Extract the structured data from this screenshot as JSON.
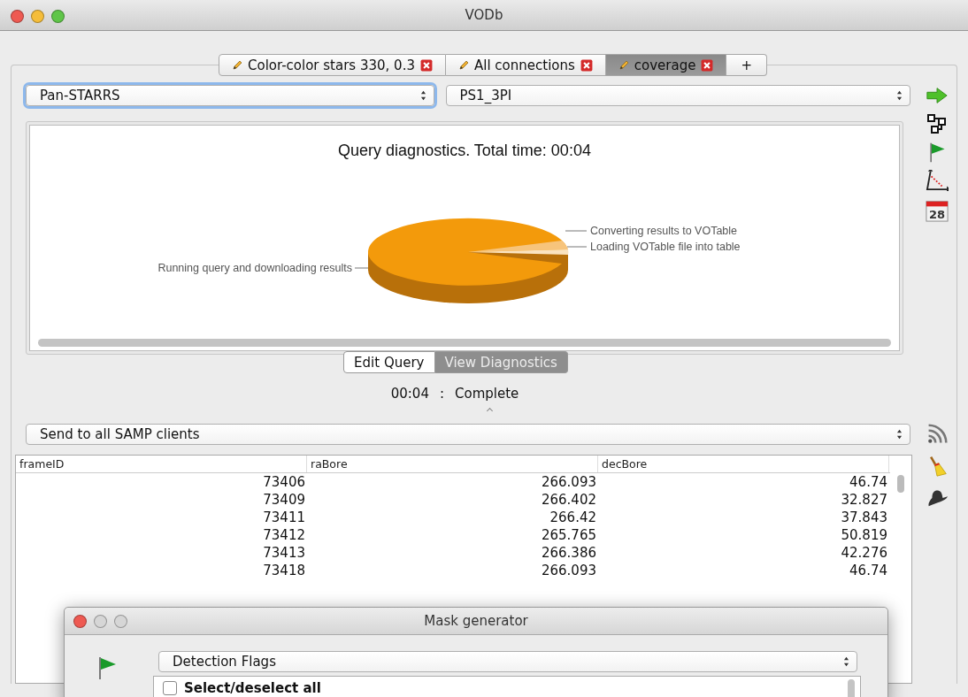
{
  "window": {
    "title": "VODb"
  },
  "tabs": [
    {
      "kind": "document",
      "label": "Color-color stars 330, 0.3",
      "selected": false
    },
    {
      "kind": "document",
      "label": "All connections",
      "selected": false
    },
    {
      "kind": "document",
      "label": "coverage",
      "selected": true
    },
    {
      "kind": "add",
      "label": "+",
      "selected": false
    }
  ],
  "catalog_select": {
    "value": "Pan-STARRS",
    "focused": true
  },
  "table_select": {
    "value": "PS1_3PI",
    "focused": false
  },
  "chart": {
    "title": "Query diagnostics. Total time: 00:04",
    "slices": [
      {
        "label": "Running query and downloading results",
        "color": "#f39a0b"
      },
      {
        "label": "Converting results to VOTable",
        "color": "#f7c47c"
      },
      {
        "label": "Loading VOTable file into table",
        "color": "#fae3c0"
      }
    ]
  },
  "view_buttons": [
    {
      "label": "Edit Query",
      "selected": false
    },
    {
      "label": "View Diagnostics",
      "selected": true
    }
  ],
  "calendar_icon": {
    "day": "28"
  },
  "status": {
    "time": "00:04",
    "separator": ":",
    "state": "Complete"
  },
  "samp_select": {
    "value": "Send to all SAMP clients"
  },
  "table": {
    "columns": [
      "frameID",
      "raBore",
      "decBore"
    ],
    "rows": [
      [
        "73406",
        "266.093",
        "46.74"
      ],
      [
        "73409",
        "266.402",
        "32.827"
      ],
      [
        "73411",
        "266.42",
        "37.843"
      ],
      [
        "73412",
        "265.765",
        "50.819"
      ],
      [
        "73413",
        "266.386",
        "42.276"
      ],
      [
        "73418",
        "266.093",
        "46.74"
      ]
    ]
  },
  "mask_dialog": {
    "title": "Mask generator",
    "select": {
      "value": "Detection Flags"
    },
    "options": [
      {
        "label": "Select/deselect all",
        "checked": false
      }
    ]
  }
}
